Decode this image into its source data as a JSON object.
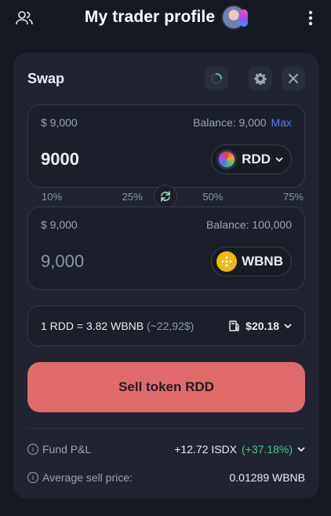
{
  "header": {
    "title": "My trader profile"
  },
  "swap": {
    "title": "Swap",
    "from": {
      "usd": "$ 9,000",
      "balance": "Balance: 9,000",
      "max": "Max",
      "amount": "9000",
      "token": "RDD"
    },
    "percents": [
      "10%",
      "25%",
      "50%",
      "75%"
    ],
    "to": {
      "usd": "$ 9,000",
      "balance": "Balance: 100,000",
      "amount": "9,000",
      "token": "WBNB"
    },
    "rate": {
      "text": "1 RDD = 3.82 WBNB",
      "approx": "(~22,92$)",
      "gas": "$20.18"
    },
    "sell_label": "Sell token RDD",
    "fund_pl": {
      "label": "Fund P&L",
      "value": "+12.72 ISDX",
      "pct": "(+37.18%)"
    },
    "avg_price": {
      "label": "Average sell price:",
      "value": "0.01289 WBNB"
    }
  },
  "colors": {
    "accent": "#4d7cff",
    "sell": "#e06a6a",
    "positive": "#46c98a"
  }
}
